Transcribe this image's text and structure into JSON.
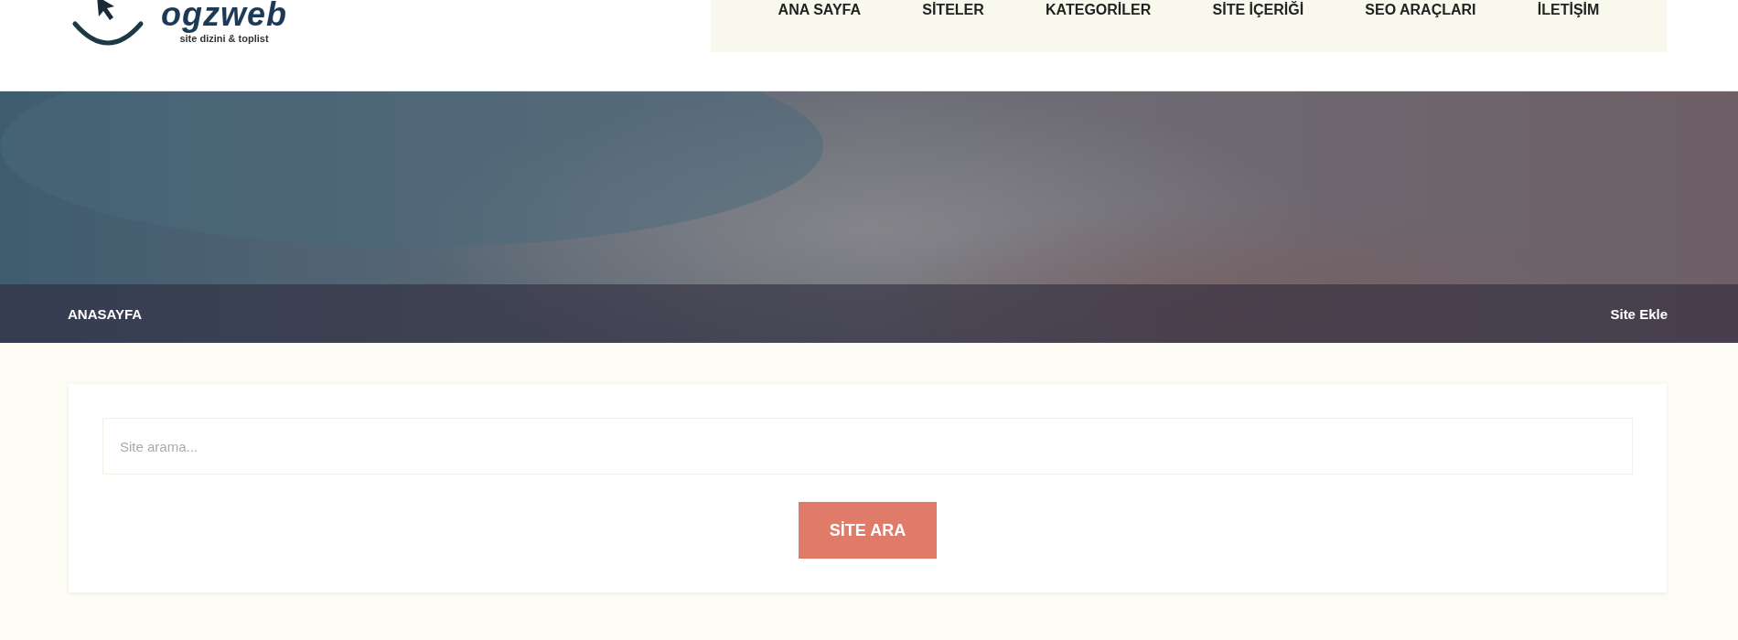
{
  "logo": {
    "name": "ogzweb",
    "tagline": "site dizini & toplist"
  },
  "nav": [
    {
      "label": "ANA SAYFA"
    },
    {
      "label": "SİTELER"
    },
    {
      "label": "KATEGORİLER"
    },
    {
      "label": "SİTE İÇERİĞİ"
    },
    {
      "label": "SEO ARAÇLARI"
    },
    {
      "label": "İLETİŞİM"
    }
  ],
  "breadcrumb": {
    "current": "ANASAYFA",
    "action": "Site Ekle"
  },
  "search": {
    "placeholder": "Site arama...",
    "button": "SİTE ARA"
  }
}
